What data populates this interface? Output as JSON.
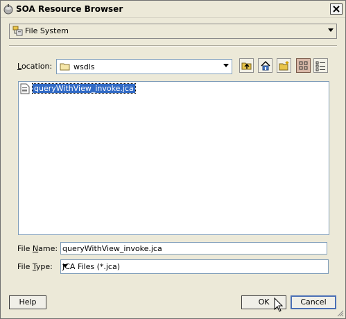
{
  "window": {
    "title": "SOA Resource Browser"
  },
  "source_selector": {
    "value": "File System"
  },
  "location": {
    "label": "Location:",
    "value": "wsdls"
  },
  "toolbar": {
    "icons": [
      "up-folder-icon",
      "home-icon",
      "new-folder-icon",
      "list-view-icon",
      "details-view-icon"
    ]
  },
  "files": [
    {
      "name": "queryWithView_invoke.jca",
      "selected": true
    }
  ],
  "file_name": {
    "label": "File Name:",
    "value": "queryWithView_invoke.jca"
  },
  "file_type": {
    "label": "File Type:",
    "value": "JCA Files (*.jca)"
  },
  "buttons": {
    "help": "Help",
    "ok": "OK",
    "cancel": "Cancel"
  }
}
